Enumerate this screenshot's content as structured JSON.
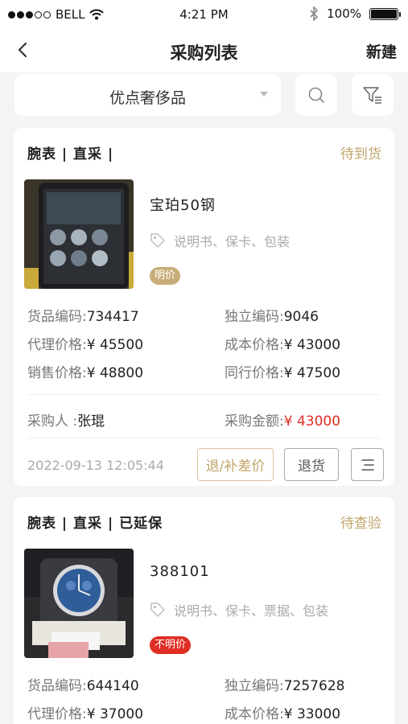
{
  "status_bar": {
    "carrier": "BELL",
    "time": "4:21 PM",
    "battery": "100%"
  },
  "nav": {
    "title": "采购列表",
    "new_label": "新建"
  },
  "search": {
    "selected_option": "优点奢侈品"
  },
  "orders": [
    {
      "header": "腕表 | 直采 |",
      "status": "待到货",
      "product_name": "宝珀50钢",
      "accessories": "说明书、保卡、包装",
      "price_badge": "明价",
      "goods_code_label": "货品编码:",
      "goods_code": "734417",
      "unique_code_label": "独立编码:",
      "unique_code": "9046",
      "agent_price_label": "代理价格:",
      "agent_price": "¥ 45500",
      "cost_price_label": "成本价格:",
      "cost_price": "¥ 43000",
      "sale_price_label": "销售价格:",
      "sale_price": "¥ 48800",
      "peer_price_label": "同行价格:",
      "peer_price": "¥ 47500",
      "buyer_label": "采购人 :",
      "buyer": "张琨",
      "amount_label": "采购金额:",
      "amount": "¥ 43000",
      "datetime": "2022-09-13 12:05:44",
      "refund_diff_label": "退/补差价",
      "return_label": "退货"
    },
    {
      "header": "腕表 | 直采 | 已延保",
      "status": "待查验",
      "product_name": "388101",
      "accessories": "说明书、保卡、票据、包装",
      "price_badge": "不明价",
      "goods_code_label": "货品编码:",
      "goods_code": "644140",
      "unique_code_label": "独立编码:",
      "unique_code": "7257628",
      "agent_price_label": "代理价格:",
      "agent_price": "¥ 37000",
      "cost_price_label": "成本价格:",
      "cost_price": "¥ 33000"
    }
  ],
  "colors": {
    "accent_gold": "#c2a56a",
    "alert_red": "#e02e24",
    "background": "#f4f4f4"
  },
  "icons": [
    "wifi-icon",
    "bluetooth-icon",
    "back-chevron-icon",
    "search-icon",
    "filter-icon",
    "tag-icon",
    "menu-lines-icon"
  ]
}
